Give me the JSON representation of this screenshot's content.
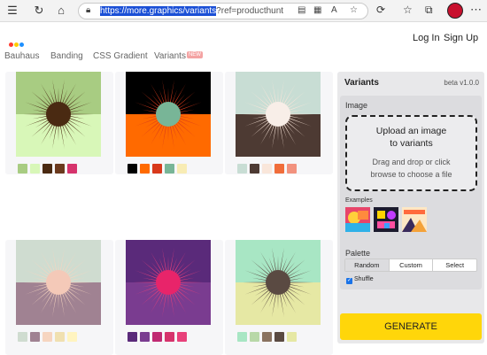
{
  "browser": {
    "url_selected": "https://more.graphics/variants",
    "url_rest": "?ref=producthunt"
  },
  "header": {
    "login": "Log In",
    "signup": "Sign Up",
    "logo_colors": [
      "#ff3b30",
      "#ffcc00",
      "#1e90ff"
    ]
  },
  "tabs": [
    {
      "label": "Bauhaus"
    },
    {
      "label": "Banding"
    },
    {
      "label": "CSS Gradient"
    },
    {
      "label": "Variants",
      "badge": "NEW"
    }
  ],
  "gallery": [
    {
      "top": "#a8cc82",
      "bottom": "#d8f7b8",
      "sun": "#4a2a12",
      "center": "#4a2a12",
      "swatches": [
        "#a8cc82",
        "#d8f7b8",
        "#4a2a12",
        "#6b3a1e",
        "#d6336c"
      ]
    },
    {
      "top": "#000000",
      "bottom": "#ff6a00",
      "sun": "#d8391b",
      "center": "#78b597",
      "swatches": [
        "#000000",
        "#ff6a00",
        "#d8391b",
        "#78b597",
        "#f8ecb4"
      ]
    },
    {
      "top": "#c8ddd4",
      "bottom": "#4d3a33",
      "sun": "#f9e6da",
      "center": "#f8eee8",
      "swatches": [
        "#c8ddd4",
        "#4d3a33",
        "#f9e6da",
        "#f06d3a",
        "#f2927e"
      ]
    },
    {
      "top": "#cfdcd0",
      "bottom": "#a08292",
      "sun": "#f6d5c0",
      "center": "#f4c9b8",
      "swatches": [
        "#cfdcd0",
        "#a08292",
        "#f6d5c0",
        "#f0e0b0",
        "#fff4c0"
      ]
    },
    {
      "top": "#5a2a7a",
      "bottom": "#7a3c90",
      "sun": "#e8407a",
      "center": "#e8246a",
      "swatches": [
        "#5a2a7a",
        "#7a3c90",
        "#c02a72",
        "#d6336c",
        "#e8407a"
      ]
    },
    {
      "top": "#a8e6c4",
      "bottom": "#e6e8a4",
      "sun": "#5a4a42",
      "center": "#5a4a42",
      "swatches": [
        "#a8e6c4",
        "#b8d8a8",
        "#8a7260",
        "#5a4a42",
        "#e6e8a4"
      ]
    }
  ],
  "panel": {
    "title": "Variants",
    "version": "beta v1.0.0",
    "image_label": "Image",
    "upload_line1": "Upload an image",
    "upload_line2": "to variants",
    "drag_line1": "Drag and drop or click",
    "drag_line2": "browse to choose a file",
    "examples_label": "Examples",
    "palette_label": "Palette",
    "palette_options": [
      "Random",
      "Custom",
      "Select"
    ],
    "palette_selected": "Random",
    "shuffle_label": "Shuffle",
    "shuffle_checked": true,
    "generate_label": "GENERATE",
    "generate_color": "#ffd60a"
  }
}
